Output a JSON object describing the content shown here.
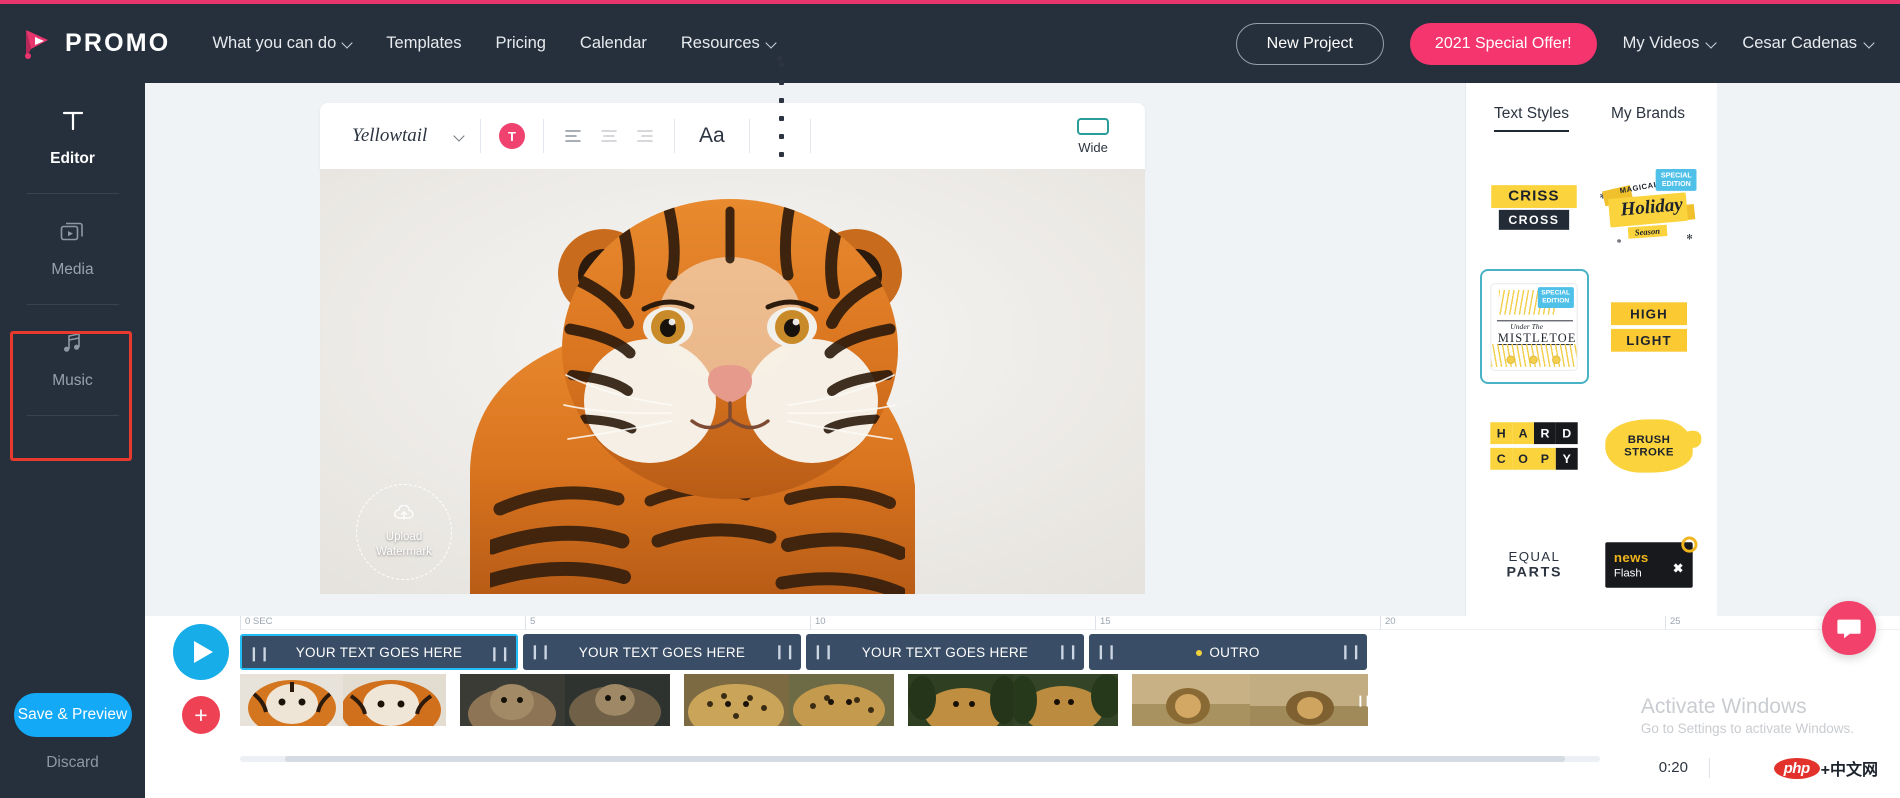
{
  "header": {
    "brand": "PROMO",
    "nav": [
      {
        "label": "What you can do",
        "caret": true
      },
      {
        "label": "Templates",
        "caret": false
      },
      {
        "label": "Pricing",
        "caret": false
      },
      {
        "label": "Calendar",
        "caret": false
      },
      {
        "label": "Resources",
        "caret": true
      }
    ],
    "new_project": "New Project",
    "special_offer": "2021 Special Offer!",
    "my_videos": "My Videos",
    "account": "Cesar Cadenas"
  },
  "rail": {
    "items": [
      {
        "label": "Editor",
        "icon": "text-tool-icon",
        "active": true
      },
      {
        "label": "Media",
        "icon": "media-library-icon",
        "active": false
      },
      {
        "label": "Music",
        "icon": "music-note-icon",
        "active": false
      }
    ],
    "save_label": "Save & Preview",
    "discard_label": "Discard"
  },
  "toolbar": {
    "font_name": "Yellowtail",
    "color_letter": "T",
    "color_value": "#f0426e",
    "align_left": "align-left",
    "align_center": "align-center",
    "align_right": "align-right",
    "size_label": "Aa",
    "grid_label": "grid-icon",
    "ratio_label": "Wide"
  },
  "canvas": {
    "watermark_line1": "Upload",
    "watermark_line2": "Watermark"
  },
  "right_panel": {
    "tabs": [
      {
        "label": "Text Styles",
        "active": true
      },
      {
        "label": "My Brands",
        "active": false
      }
    ],
    "styles": [
      {
        "id": "criss-cross",
        "line1": "CRISS",
        "line2": "CROSS",
        "selected": false
      },
      {
        "id": "magical-holiday",
        "magical": "MAGICAL",
        "main": "Holiday",
        "season": "Season",
        "badge1": "SPECIAL",
        "badge2": "EDITION",
        "selected": false
      },
      {
        "id": "under-the-mistletoe",
        "under": "Under The",
        "main": "MISTLETOE",
        "badge1": "SPECIAL",
        "badge2": "EDITION",
        "selected": true
      },
      {
        "id": "high-light",
        "line1": "HIGH",
        "line2": "LIGHT",
        "selected": false
      },
      {
        "id": "hard-copy",
        "line1": "HARD",
        "line2": "COPY",
        "selected": false
      },
      {
        "id": "brush-stroke",
        "line1": "BRUSH",
        "line2": "STROKE",
        "selected": false
      },
      {
        "id": "equal-parts",
        "line1": "EQUAL",
        "line2": "PARTS",
        "selected": false
      },
      {
        "id": "news-flash",
        "line1": "news",
        "line2": "Flash",
        "close": "✖",
        "selected": false
      }
    ]
  },
  "timeline": {
    "ruler_ticks": [
      "0 SEC",
      "5",
      "10",
      "15",
      "20",
      "25"
    ],
    "clips": [
      {
        "label": "YOUR TEXT GOES HERE",
        "selected": true,
        "dot": false
      },
      {
        "label": "YOUR TEXT GOES HERE",
        "selected": false,
        "dot": false
      },
      {
        "label": "YOUR TEXT GOES HERE",
        "selected": false,
        "dot": false
      },
      {
        "label": "OUTRO",
        "selected": false,
        "dot": true
      }
    ],
    "duration": "0:20"
  },
  "os_notice": {
    "title": "Activate Windows",
    "subtitle": "Go to Settings to activate Windows."
  },
  "watermark": {
    "php": "php",
    "cn": "+中文网"
  }
}
